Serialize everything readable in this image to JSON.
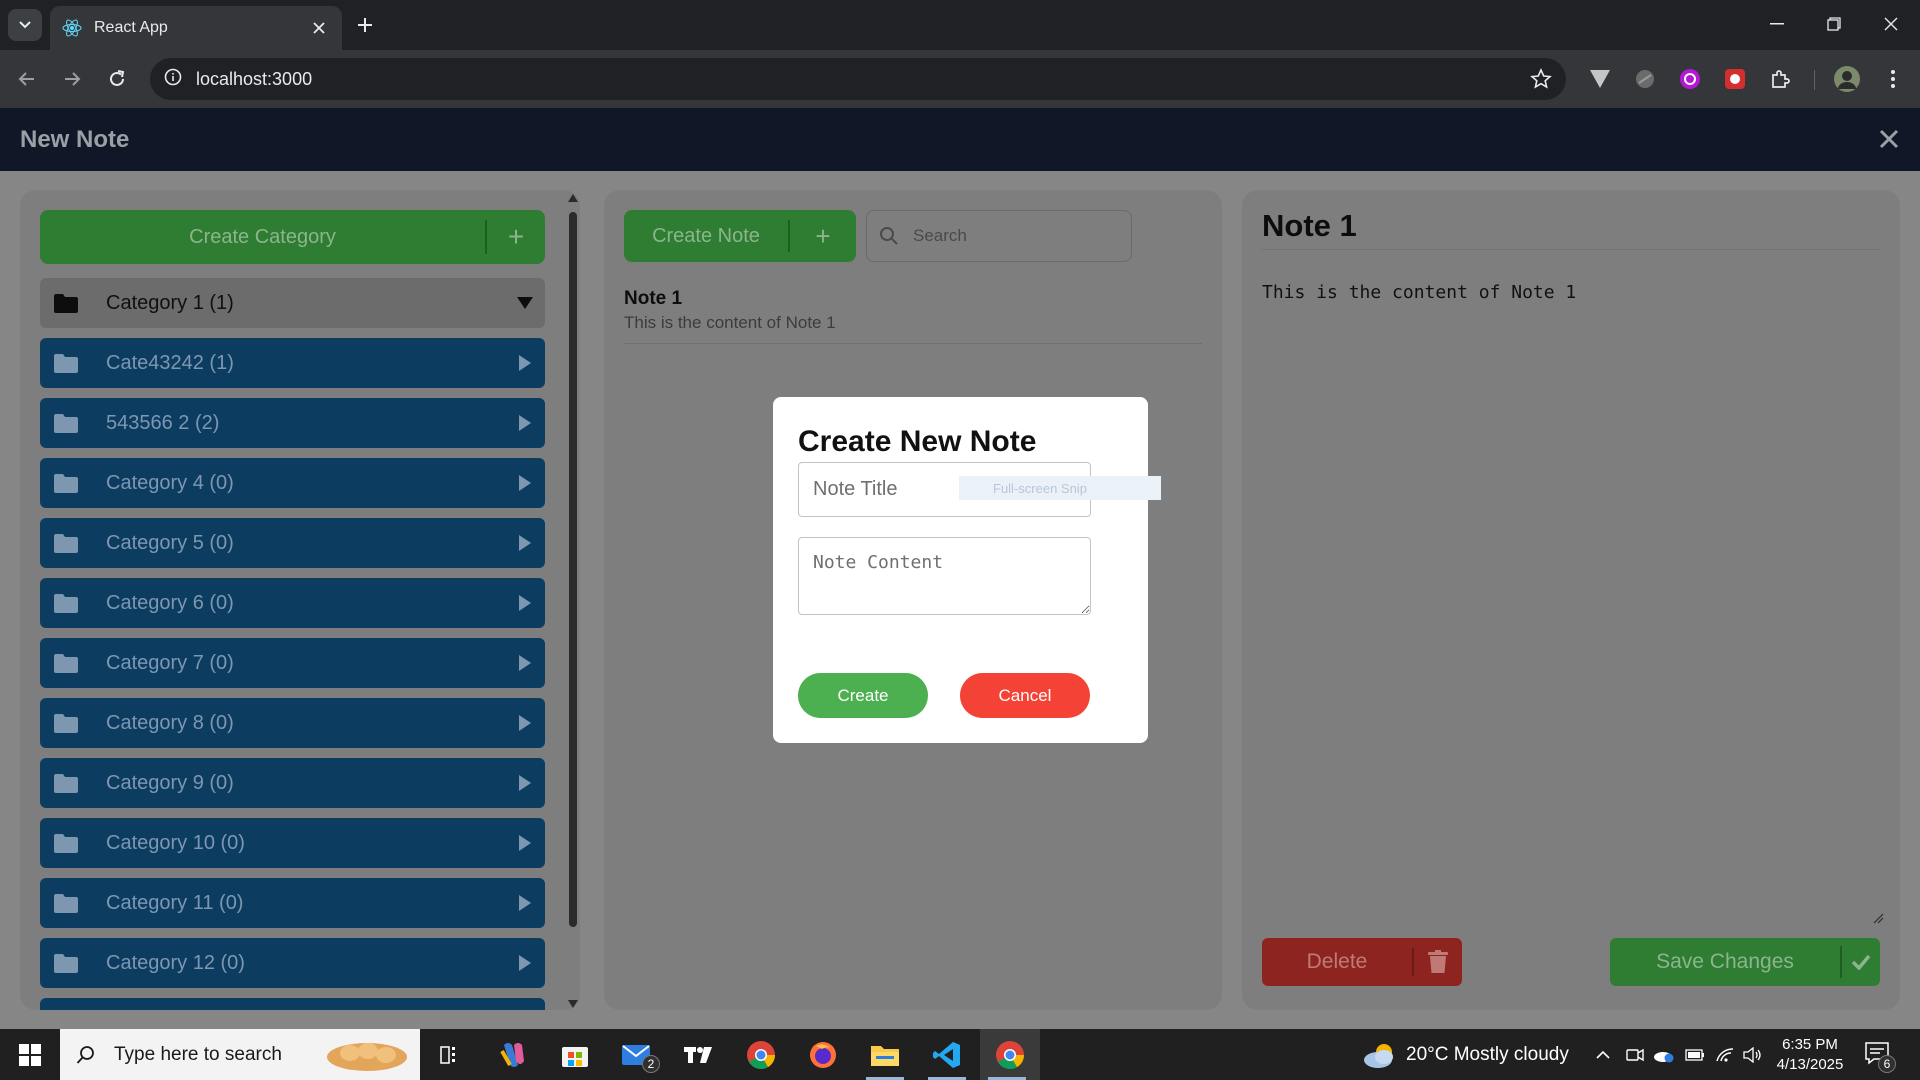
{
  "browser": {
    "tab_title": "React App",
    "url": "localhost:3000"
  },
  "app": {
    "header_title": "New Note",
    "sidebar": {
      "create_category_label": "Create Category",
      "create_category_plus": "+",
      "categories": [
        {
          "label": "Category 1 (1)",
          "expanded": true
        },
        {
          "label": "Cate43242 (1)",
          "expanded": false
        },
        {
          "label": "543566 2 (2)",
          "expanded": false
        },
        {
          "label": "Category 4 (0)",
          "expanded": false
        },
        {
          "label": "Category 5 (0)",
          "expanded": false
        },
        {
          "label": "Category 6 (0)",
          "expanded": false
        },
        {
          "label": "Category 7 (0)",
          "expanded": false
        },
        {
          "label": "Category 8 (0)",
          "expanded": false
        },
        {
          "label": "Category 9 (0)",
          "expanded": false
        },
        {
          "label": "Category 10 (0)",
          "expanded": false
        },
        {
          "label": "Category 11 (0)",
          "expanded": false
        },
        {
          "label": "Category 12 (0)",
          "expanded": false
        }
      ]
    },
    "notes_panel": {
      "create_note_label": "Create Note",
      "create_note_plus": "+",
      "search_placeholder": "Search",
      "notes": [
        {
          "title": "Note 1",
          "preview": "This is the content of Note 1"
        }
      ]
    },
    "editor": {
      "title": "Note 1",
      "content": "This is the content of Note 1",
      "delete_label": "Delete",
      "save_label": "Save Changes"
    },
    "modal": {
      "heading": "Create New Note",
      "title_placeholder": "Note Title",
      "content_placeholder": "Note Content",
      "create_label": "Create",
      "cancel_label": "Cancel",
      "snip_overlay_text": "Full-screen Snip"
    }
  },
  "taskbar": {
    "search_placeholder": "Type here to search",
    "mail_badge": "2",
    "weather": "20°C  Mostly cloudy",
    "time": "6:35 PM",
    "date": "4/13/2025",
    "notification_count": "6"
  },
  "colors": {
    "green": "#2e7d32",
    "blue_category": "#0d3c61",
    "red": "#8e2420",
    "modal_create": "#4caf50",
    "modal_cancel": "#f44336"
  }
}
